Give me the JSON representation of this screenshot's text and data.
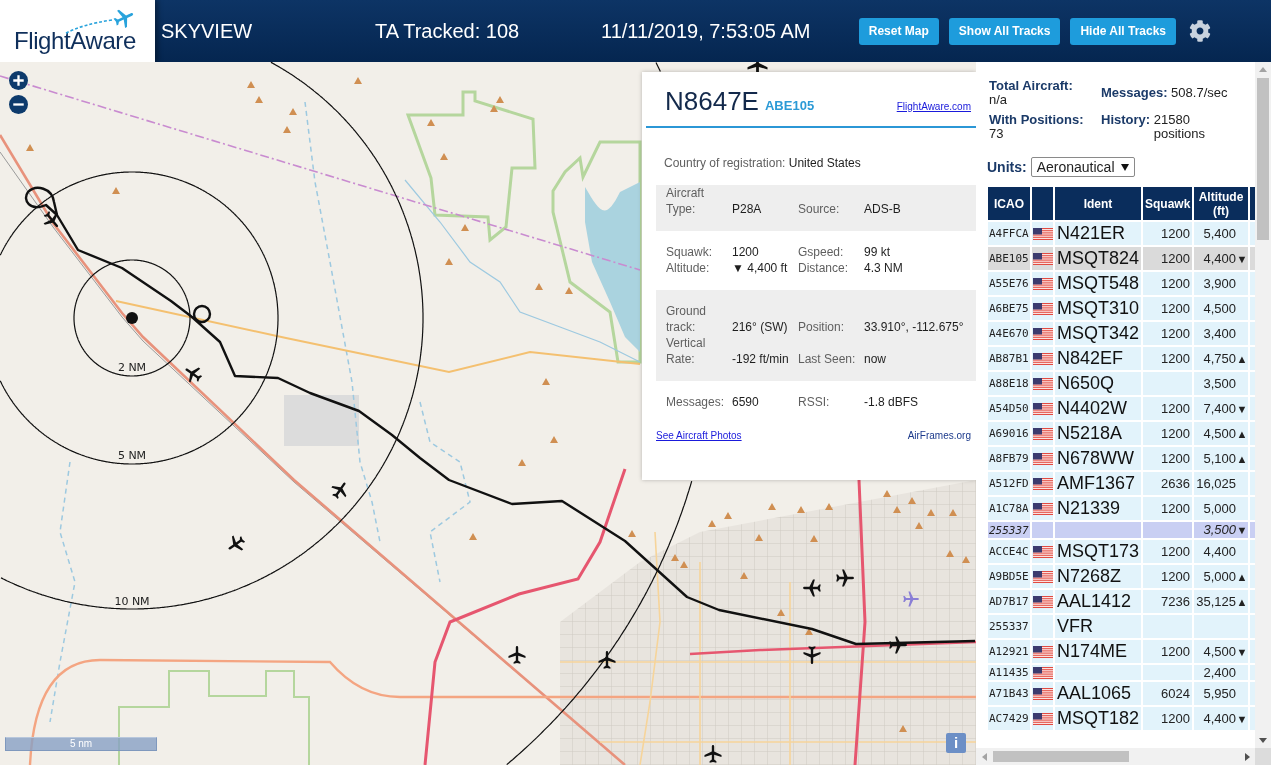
{
  "header": {
    "logo": "FlightAware",
    "title": "SKYVIEW",
    "tracked": "TA Tracked: 108",
    "datetime": "11/11/2019, 7:53:05 AM",
    "buttons": [
      "Reset Map",
      "Show All Tracks",
      "Hide All Tracks"
    ]
  },
  "map": {
    "range_labels": [
      "2 NM",
      "5 NM",
      "10 NM"
    ],
    "scale": "5 nm",
    "info_button": "i"
  },
  "aircraft_info": {
    "registration": "N8647E",
    "callsign": "ABE105",
    "site_link": "FlightAware.com",
    "country_label": "Country of registration:",
    "country": "United States",
    "sections": [
      {
        "rows": [
          [
            {
              "label": "Aircraft Type:",
              "value": "P28A"
            },
            {
              "label": "Source:",
              "value": "ADS-B"
            }
          ]
        ]
      },
      {
        "rows": [
          [
            {
              "label": "Squawk:",
              "value": "1200"
            },
            {
              "label": "Gspeed:",
              "value": "99 kt"
            }
          ],
          [
            {
              "label": "Altitude:",
              "value": "▼ 4,400 ft"
            },
            {
              "label": "Distance:",
              "value": "4.3 NM"
            }
          ]
        ]
      },
      {
        "rows": [
          [
            {
              "label": "Ground track:",
              "value": "216° (SW)"
            },
            {
              "label": "Position:",
              "value": "33.910°, -112.675°"
            }
          ],
          [
            {
              "label": "Vertical Rate:",
              "value": "-192 ft/min"
            },
            {
              "label": "Last Seen:",
              "value": "now"
            }
          ]
        ]
      },
      {
        "rows": [
          [
            {
              "label": "Messages:",
              "value": "6590"
            },
            {
              "label": "RSSI:",
              "value": "-1.8 dBFS"
            }
          ]
        ]
      }
    ],
    "photos_link": "See Aircraft Photos",
    "airframes_link": "AirFrames.org"
  },
  "stats": [
    {
      "label": "Total Aircraft:",
      "value": "n/a"
    },
    {
      "label": "Messages:",
      "value": "508.7/sec"
    },
    {
      "label": "With Positions:",
      "value": "73"
    },
    {
      "label": "History:",
      "value": "21580 positions"
    }
  ],
  "units": {
    "label": "Units:",
    "value": "Aeronautical"
  },
  "table": {
    "columns": [
      "ICAO",
      "Ident",
      "Squawk",
      "Altitude (ft)"
    ],
    "rows": [
      {
        "icao": "A4FFCA",
        "flag": true,
        "ident": "N421ER",
        "squawk": "1200",
        "altitude": "5,400",
        "selected": false,
        "highlighted": false
      },
      {
        "icao": "ABE105",
        "flag": true,
        "ident": "MSQT824",
        "squawk": "1200",
        "altitude": "4,400",
        "trend": "▼",
        "selected": true,
        "highlighted": false
      },
      {
        "icao": "A55E76",
        "flag": true,
        "ident": "MSQT548",
        "squawk": "1200",
        "altitude": "3,900",
        "selected": false,
        "highlighted": false
      },
      {
        "icao": "A6BE75",
        "flag": true,
        "ident": "MSQT310",
        "squawk": "1200",
        "altitude": "4,500",
        "selected": false,
        "highlighted": false
      },
      {
        "icao": "A4E670",
        "flag": true,
        "ident": "MSQT342",
        "squawk": "1200",
        "altitude": "3,400",
        "selected": false,
        "highlighted": false
      },
      {
        "icao": "AB87B1",
        "flag": true,
        "ident": "N842EF",
        "squawk": "1200",
        "altitude": "4,750",
        "trend": "▲",
        "selected": false,
        "highlighted": false
      },
      {
        "icao": "A88E18",
        "flag": true,
        "ident": "N650Q",
        "altitude": "3,500",
        "selected": false,
        "highlighted": false
      },
      {
        "icao": "A54D50",
        "flag": true,
        "ident": "N4402W",
        "squawk": "1200",
        "altitude": "7,400",
        "trend": "▼",
        "selected": false,
        "highlighted": false
      },
      {
        "icao": "A69016",
        "flag": true,
        "ident": "N5218A",
        "squawk": "1200",
        "altitude": "4,500",
        "trend": "▲",
        "selected": false,
        "highlighted": false
      },
      {
        "icao": "A8FB79",
        "flag": true,
        "ident": "N678WW",
        "squawk": "1200",
        "altitude": "5,100",
        "trend": "▲",
        "selected": false,
        "highlighted": false
      },
      {
        "icao": "A512FD",
        "flag": true,
        "ident": "AMF1367",
        "squawk": "2636",
        "altitude": "16,025",
        "selected": false,
        "highlighted": false
      },
      {
        "icao": "A1C78A",
        "flag": true,
        "ident": "N21339",
        "squawk": "1200",
        "altitude": "5,000",
        "selected": false,
        "highlighted": false
      },
      {
        "icao": "255337",
        "flag": false,
        "altitude": "3,500",
        "trend": "▼",
        "selected": false,
        "highlighted": true
      },
      {
        "icao": "ACCE4C",
        "flag": true,
        "ident": "MSQT173",
        "squawk": "1200",
        "altitude": "4,400",
        "selected": false,
        "highlighted": false
      },
      {
        "icao": "A9BD5E",
        "flag": true,
        "ident": "N7268Z",
        "squawk": "1200",
        "altitude": "5,000",
        "trend": "▲",
        "selected": false,
        "highlighted": false
      },
      {
        "icao": "AD7B17",
        "flag": true,
        "ident": "AAL1412",
        "squawk": "7236",
        "altitude": "35,125",
        "trend": "▲",
        "selected": false,
        "highlighted": false
      },
      {
        "icao": "255337",
        "flag": false,
        "ident": "VFR",
        "selected": false,
        "highlighted": false
      },
      {
        "icao": "A12921",
        "flag": true,
        "ident": "N174ME",
        "squawk": "1200",
        "altitude": "4,500",
        "trend": "▼",
        "selected": false,
        "highlighted": false
      },
      {
        "icao": "A11435",
        "flag": true,
        "altitude": "2,400",
        "selected": false,
        "highlighted": false
      },
      {
        "icao": "A71B43",
        "flag": true,
        "ident": "AAL1065",
        "squawk": "6024",
        "altitude": "5,950",
        "selected": false,
        "highlighted": false
      },
      {
        "icao": "AC7429",
        "flag": true,
        "ident": "MSQT182",
        "squawk": "1200",
        "altitude": "4,400",
        "trend": "▼",
        "selected": false,
        "highlighted": false
      }
    ]
  }
}
